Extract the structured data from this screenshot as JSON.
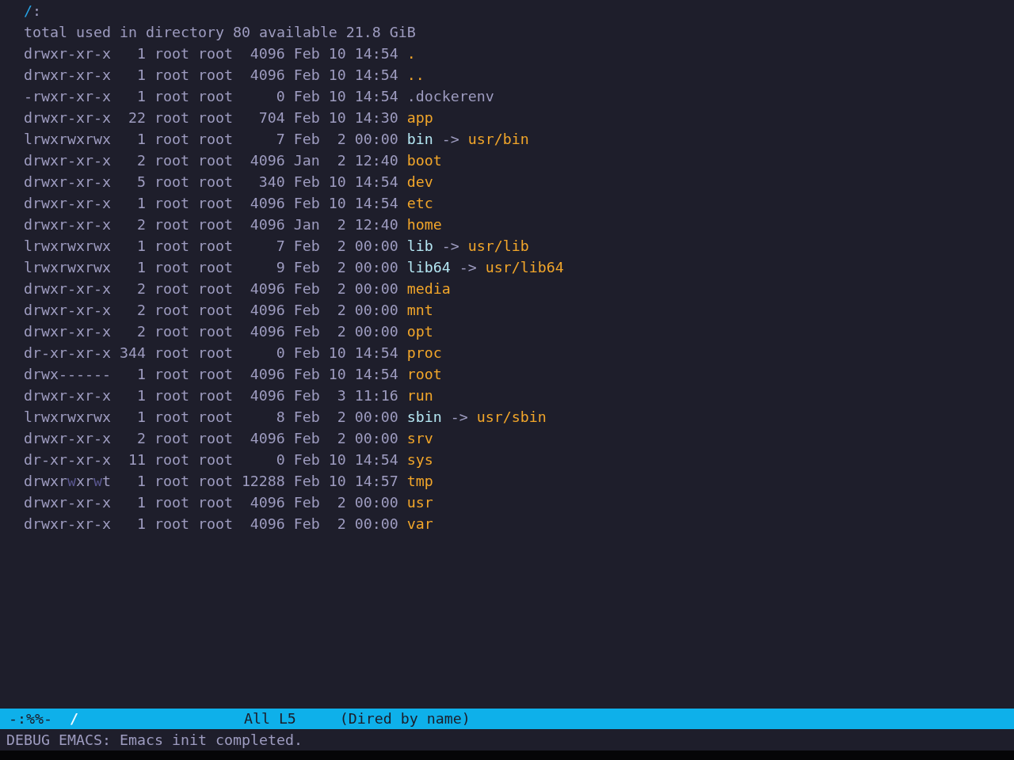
{
  "buffer": {
    "heading": {
      "directory": "/",
      "colon": ":"
    },
    "summary": "total used in directory 80 available 21.8 GiB",
    "entries": [
      {
        "kind": "directory",
        "permissions": "drwxr-xr-x",
        "links": "1",
        "owner": "root",
        "group": "root",
        "size": "4096",
        "month": "Feb",
        "day": "10",
        "time": "14:54",
        "name": "."
      },
      {
        "kind": "directory",
        "permissions": "drwxr-xr-x",
        "links": "1",
        "owner": "root",
        "group": "root",
        "size": "4096",
        "month": "Feb",
        "day": "10",
        "time": "14:54",
        "name": ".."
      },
      {
        "kind": "file",
        "permissions": "-rwxr-xr-x",
        "links": "1",
        "owner": "root",
        "group": "root",
        "size": "0",
        "month": "Feb",
        "day": "10",
        "time": "14:54",
        "name": ".dockerenv"
      },
      {
        "kind": "directory",
        "permissions": "drwxr-xr-x",
        "links": "22",
        "owner": "root",
        "group": "root",
        "size": "704",
        "month": "Feb",
        "day": "10",
        "time": "14:30",
        "name": "app"
      },
      {
        "kind": "symlink",
        "permissions": "lrwxrwxrwx",
        "links": "1",
        "owner": "root",
        "group": "root",
        "size": "7",
        "month": "Feb",
        "day": "2",
        "time": "00:00",
        "name": "bin",
        "arrow": "->",
        "target": "usr/bin"
      },
      {
        "kind": "directory",
        "permissions": "drwxr-xr-x",
        "links": "2",
        "owner": "root",
        "group": "root",
        "size": "4096",
        "month": "Jan",
        "day": "2",
        "time": "12:40",
        "name": "boot"
      },
      {
        "kind": "directory",
        "permissions": "drwxr-xr-x",
        "links": "5",
        "owner": "root",
        "group": "root",
        "size": "340",
        "month": "Feb",
        "day": "10",
        "time": "14:54",
        "name": "dev"
      },
      {
        "kind": "directory",
        "permissions": "drwxr-xr-x",
        "links": "1",
        "owner": "root",
        "group": "root",
        "size": "4096",
        "month": "Feb",
        "day": "10",
        "time": "14:54",
        "name": "etc"
      },
      {
        "kind": "directory",
        "permissions": "drwxr-xr-x",
        "links": "2",
        "owner": "root",
        "group": "root",
        "size": "4096",
        "month": "Jan",
        "day": "2",
        "time": "12:40",
        "name": "home"
      },
      {
        "kind": "symlink",
        "permissions": "lrwxrwxrwx",
        "links": "1",
        "owner": "root",
        "group": "root",
        "size": "7",
        "month": "Feb",
        "day": "2",
        "time": "00:00",
        "name": "lib",
        "arrow": "->",
        "target": "usr/lib"
      },
      {
        "kind": "symlink",
        "permissions": "lrwxrwxrwx",
        "links": "1",
        "owner": "root",
        "group": "root",
        "size": "9",
        "month": "Feb",
        "day": "2",
        "time": "00:00",
        "name": "lib64",
        "arrow": "->",
        "target": "usr/lib64"
      },
      {
        "kind": "directory",
        "permissions": "drwxr-xr-x",
        "links": "2",
        "owner": "root",
        "group": "root",
        "size": "4096",
        "month": "Feb",
        "day": "2",
        "time": "00:00",
        "name": "media"
      },
      {
        "kind": "directory",
        "permissions": "drwxr-xr-x",
        "links": "2",
        "owner": "root",
        "group": "root",
        "size": "4096",
        "month": "Feb",
        "day": "2",
        "time": "00:00",
        "name": "mnt"
      },
      {
        "kind": "directory",
        "permissions": "drwxr-xr-x",
        "links": "2",
        "owner": "root",
        "group": "root",
        "size": "4096",
        "month": "Feb",
        "day": "2",
        "time": "00:00",
        "name": "opt"
      },
      {
        "kind": "directory",
        "permissions": "dr-xr-xr-x",
        "links": "344",
        "owner": "root",
        "group": "root",
        "size": "0",
        "month": "Feb",
        "day": "10",
        "time": "14:54",
        "name": "proc"
      },
      {
        "kind": "directory",
        "permissions": "drwx------",
        "links": "1",
        "owner": "root",
        "group": "root",
        "size": "4096",
        "month": "Feb",
        "day": "10",
        "time": "14:54",
        "name": "root"
      },
      {
        "kind": "directory",
        "permissions": "drwxr-xr-x",
        "links": "1",
        "owner": "root",
        "group": "root",
        "size": "4096",
        "month": "Feb",
        "day": "3",
        "time": "11:16",
        "name": "run"
      },
      {
        "kind": "symlink",
        "permissions": "lrwxrwxrwx",
        "links": "1",
        "owner": "root",
        "group": "root",
        "size": "8",
        "month": "Feb",
        "day": "2",
        "time": "00:00",
        "name": "sbin",
        "arrow": "->",
        "target": "usr/sbin"
      },
      {
        "kind": "directory",
        "permissions": "drwxr-xr-x",
        "links": "2",
        "owner": "root",
        "group": "root",
        "size": "4096",
        "month": "Feb",
        "day": "2",
        "time": "00:00",
        "name": "srv"
      },
      {
        "kind": "directory",
        "permissions": "dr-xr-xr-x",
        "links": "11",
        "owner": "root",
        "group": "root",
        "size": "0",
        "month": "Feb",
        "day": "10",
        "time": "14:54",
        "name": "sys"
      },
      {
        "kind": "directory",
        "permissions": [
          {
            "text": "drwxr",
            "highlighted": false
          },
          {
            "text": "w",
            "highlighted": true
          },
          {
            "text": "xr",
            "highlighted": false
          },
          {
            "text": "w",
            "highlighted": true
          },
          {
            "text": "t",
            "highlighted": false
          }
        ],
        "links": "1",
        "owner": "root",
        "group": "root",
        "size": "12288",
        "month": "Feb",
        "day": "10",
        "time": "14:57",
        "name": "tmp"
      },
      {
        "kind": "directory",
        "permissions": "drwxr-xr-x",
        "links": "1",
        "owner": "root",
        "group": "root",
        "size": "4096",
        "month": "Feb",
        "day": "2",
        "time": "00:00",
        "name": "usr"
      },
      {
        "kind": "directory",
        "permissions": "drwxr-xr-x",
        "links": "1",
        "owner": "root",
        "group": "root",
        "size": "4096",
        "month": "Feb",
        "day": "2",
        "time": "00:00",
        "name": "var"
      }
    ]
  },
  "mode_line": {
    "status": "-:%%-",
    "buffer_name": "/",
    "position": "All L5",
    "mode": "(Dired by name)"
  },
  "echo_area": "DEBUG EMACS: Emacs init completed."
}
